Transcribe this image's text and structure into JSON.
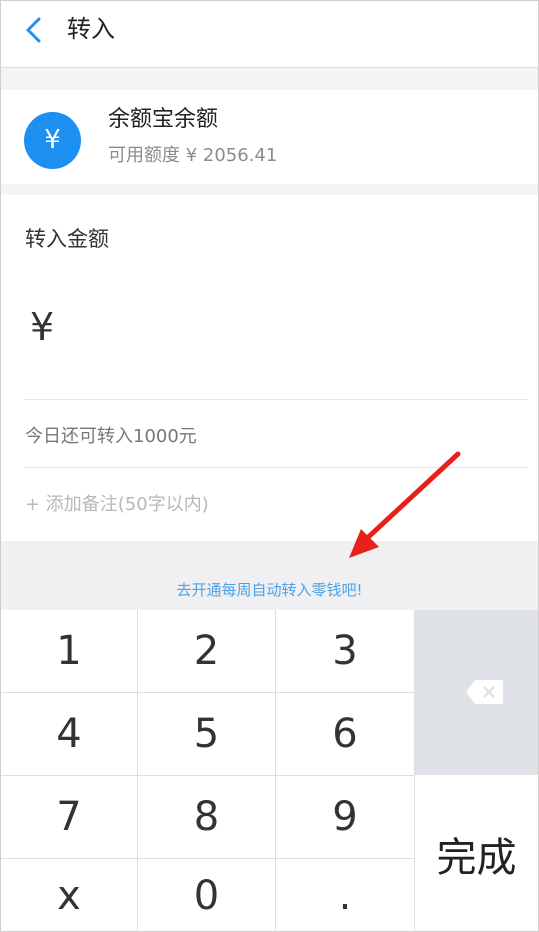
{
  "header": {
    "title": "转入"
  },
  "account": {
    "icon_text": "¥",
    "name": "余额宝余额",
    "available": "可用额度 ¥ 2056.41"
  },
  "form": {
    "amount_label": "转入金额",
    "currency_symbol": "¥",
    "limit_text": "今日还可转入1000元",
    "note_placeholder": "+ 添加备注(50字以内)"
  },
  "promo": {
    "text": "去开通每周自动转入零钱吧!"
  },
  "keypad": {
    "keys": [
      "1",
      "2",
      "3",
      "4",
      "5",
      "6",
      "7",
      "8",
      "9",
      "x",
      "0",
      "."
    ],
    "done_label": "完成"
  },
  "colors": {
    "accent": "#1d8ff0",
    "promo": "#4aa3e6",
    "arrow": "#e8201b"
  }
}
